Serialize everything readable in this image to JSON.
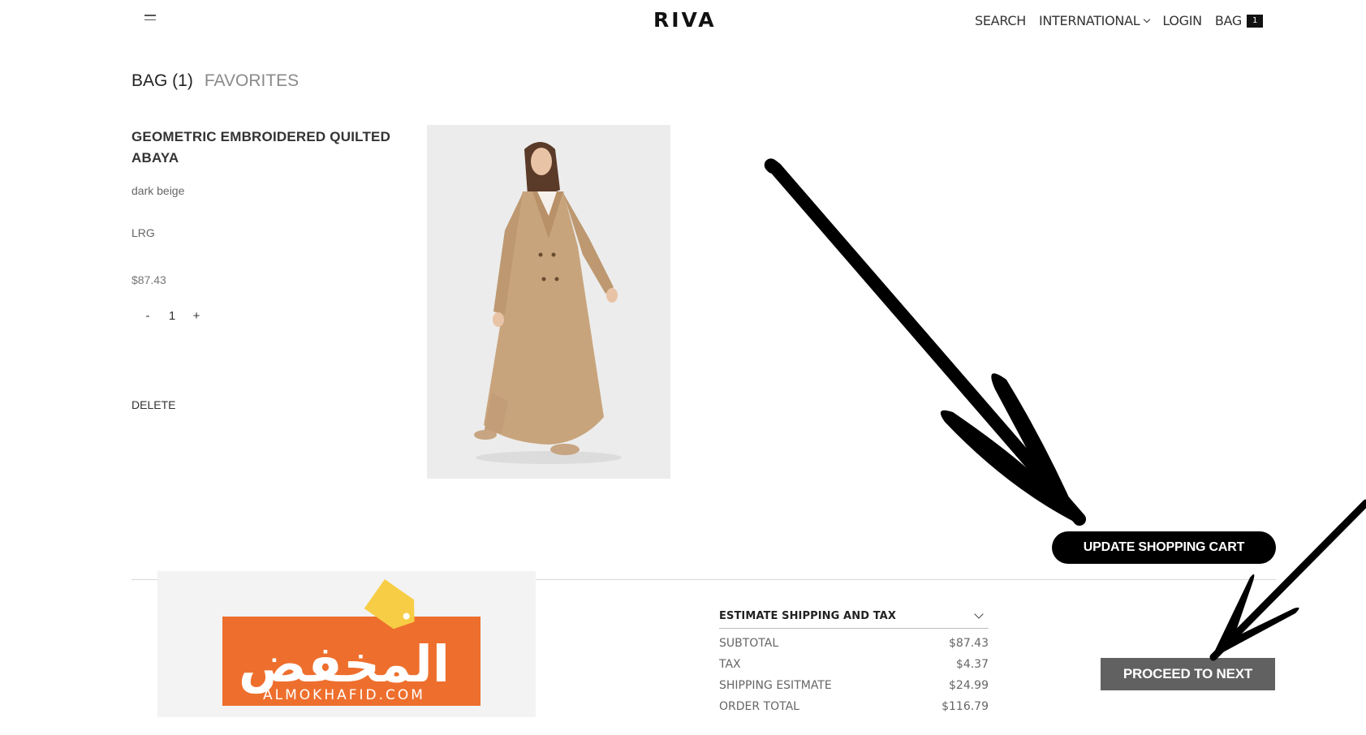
{
  "header": {
    "logo": "RIVA",
    "nav": {
      "search": "SEARCH",
      "international": "INTERNATIONAL",
      "login": "LOGIN",
      "bag": "BAG",
      "bag_count": "1"
    }
  },
  "tabs": {
    "bag": "BAG (1)",
    "favorites": "FAVORITES"
  },
  "product": {
    "name": "GEOMETRIC EMBROIDERED QUILTED ABAYA",
    "color": "dark beige",
    "size": "LRG",
    "price": "$87.43",
    "qty_minus": "-",
    "qty_value": "1",
    "qty_plus": "+",
    "delete": "DELETE"
  },
  "buttons": {
    "update_cart": "UPDATE SHOPPING CART",
    "proceed": "PROCEED TO NEXT"
  },
  "summary": {
    "estimate_label": "ESTIMATE SHIPPING AND TAX",
    "rows": [
      {
        "label": "SUBTOTAL",
        "value": "$87.43"
      },
      {
        "label": "TAX",
        "value": "$4.37"
      },
      {
        "label": "SHIPPING ESITMATE",
        "value": "$24.99"
      },
      {
        "label": "ORDER TOTAL",
        "value": "$116.79"
      }
    ]
  },
  "watermark": {
    "arabic": "المخفض",
    "latin": "ALMOKHAFID.COM"
  },
  "colors": {
    "update_button_bg": "#000000",
    "proceed_button_bg": "#616161",
    "watermark_orange": "#ee6f2d",
    "watermark_tag": "#f7cd45",
    "product_beige": "#c8a47c"
  }
}
